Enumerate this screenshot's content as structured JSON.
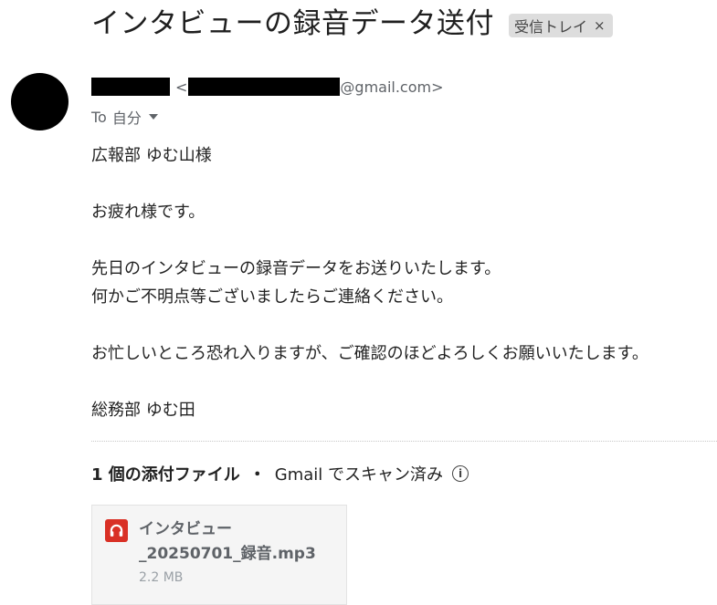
{
  "email": {
    "subject": "インタビューの録音データ送付",
    "label_chip": {
      "text": "受信トレイ",
      "close_glyph": "×"
    },
    "sender": {
      "email_open": "<",
      "email_domain": "@gmail.com>"
    },
    "recipient": {
      "to_prefix": "To",
      "to_name": "自分"
    },
    "body_lines": {
      "greeting": "広報部 ゆむ山様",
      "salutation": "お疲れ様です。",
      "line1": "先日のインタビューの録音データをお送りいたします。",
      "line2": "何かご不明点等ございましたらご連絡ください。",
      "line3": "お忙しいところ恐れ入りますが、ご確認のほどよろしくお願いいたします。",
      "signature": "総務部 ゆむ田"
    },
    "attachments": {
      "count_label": "1 個の添付ファイル",
      "separator": "・",
      "scan_status": "Gmail でスキャン済み",
      "info_icon": "info-icon",
      "items": [
        {
          "name_line1": "インタビュー",
          "name_line2": "_20250701_録音.mp3",
          "size": "2.2 MB",
          "icon": "audio-file-icon",
          "icon_color": "#d93025"
        }
      ]
    }
  }
}
